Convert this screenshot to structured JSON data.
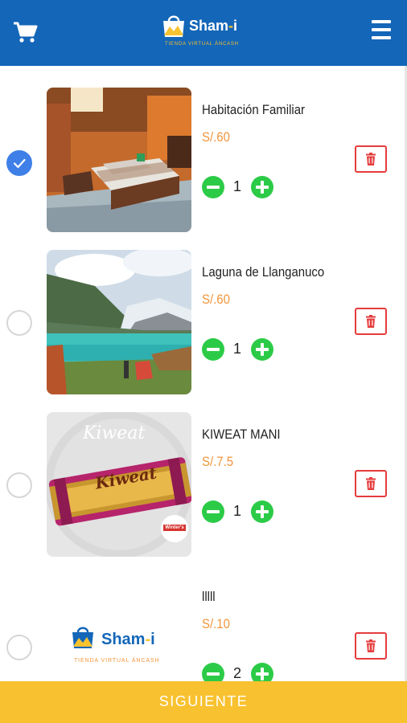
{
  "header": {
    "logo": {
      "name_main": "Sham",
      "name_dash": "-",
      "name_tail": "i",
      "tagline": "TIENDA VIRTUAL ÁNCASH"
    },
    "cart_icon": "shopping-cart-icon",
    "menu_icon": "hamburger-menu-icon",
    "color": "#1466b8"
  },
  "cart": {
    "items": [
      {
        "name": "Habitación Familiar",
        "price": "S/.60",
        "quantity": "1",
        "selected": true,
        "image": "hotel-room-photo"
      },
      {
        "name": "Laguna de Llanganuco",
        "price": "S/.60",
        "quantity": "1",
        "selected": false,
        "image": "lagoon-photo"
      },
      {
        "name": "KIWEAT MANI",
        "price": "S/.7.5",
        "quantity": "1",
        "selected": false,
        "image": "kiweat-snack-photo",
        "image_brand": "Kiweat",
        "image_badge": "Winter's"
      },
      {
        "name": "lllll",
        "price": "S/.10",
        "quantity": "2",
        "selected": false,
        "image": "sham-i-logo-placeholder",
        "logo": {
          "name_main": "Sham",
          "name_dash": "-",
          "name_tail": "i",
          "tagline": "TIENDA VIRTUAL ÁNCASH"
        }
      }
    ]
  },
  "footer": {
    "next_label": "SIGUIENTE",
    "color": "#f8c12f"
  },
  "colors": {
    "accent": "#3f80e8",
    "price": "#f2953b",
    "qty": "#2ccb47",
    "delete": "#e53c3c"
  }
}
